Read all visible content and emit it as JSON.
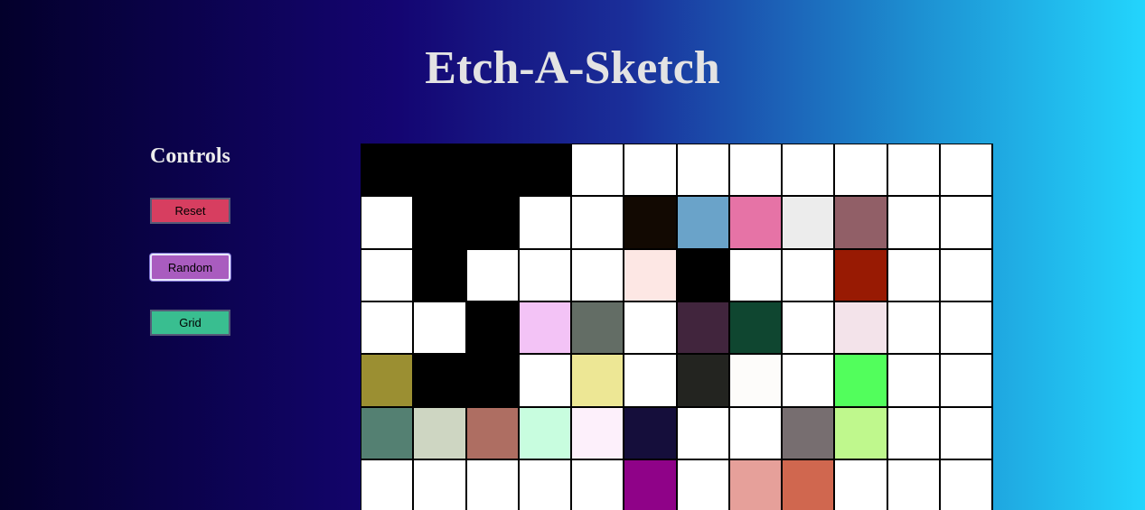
{
  "header": {
    "title": "Etch-A-Sketch"
  },
  "controls": {
    "heading": "Controls",
    "reset_label": "Reset",
    "random_label": "Random",
    "grid_label": "Grid"
  },
  "grid": {
    "columns": 12,
    "visible_rows": 7,
    "cells": [
      [
        "#000000",
        "#000000",
        "#000000",
        "#000000",
        "#ffffff",
        "#ffffff",
        "#ffffff",
        "#ffffff",
        "#ffffff",
        "#ffffff",
        "#ffffff",
        "#ffffff"
      ],
      [
        "#ffffff",
        "#000000",
        "#000000",
        "#ffffff",
        "#ffffff",
        "#120902",
        "#6aa3c9",
        "#e673a6",
        "#ececec",
        "#915f67",
        "#ffffff",
        "#ffffff"
      ],
      [
        "#ffffff",
        "#000000",
        "#ffffff",
        "#ffffff",
        "#ffffff",
        "#fde7e4",
        "#000000",
        "#ffffff",
        "#ffffff",
        "#981a03",
        "#ffffff",
        "#ffffff"
      ],
      [
        "#ffffff",
        "#ffffff",
        "#000000",
        "#f3c3f6",
        "#636d65",
        "#ffffff",
        "#41253d",
        "#0f4630",
        "#ffffff",
        "#f3e3ea",
        "#ffffff",
        "#ffffff"
      ],
      [
        "#9b8f32",
        "#000000",
        "#000000",
        "#ffffff",
        "#ede795",
        "#ffffff",
        "#232420",
        "#fdfcfa",
        "#ffffff",
        "#52fe5c",
        "#ffffff",
        "#ffffff"
      ],
      [
        "#548072",
        "#ced6c2",
        "#ae6e62",
        "#c8fddf",
        "#fdf0fb",
        "#150e3b",
        "#ffffff",
        "#ffffff",
        "#776e70",
        "#bff88d",
        "#ffffff",
        "#ffffff"
      ],
      [
        "#ffffff",
        "#ffffff",
        "#ffffff",
        "#ffffff",
        "#ffffff",
        "#8f0288",
        "#ffffff",
        "#e6a09a",
        "#d0674f",
        "#ffffff",
        "#ffffff",
        "#ffffff"
      ]
    ]
  }
}
